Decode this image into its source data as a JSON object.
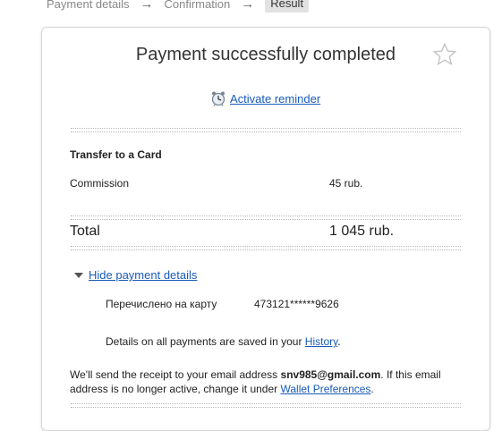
{
  "breadcrumbs": {
    "step1": "Payment details",
    "step2": "Confirmation",
    "step3": "Result",
    "separator": "→"
  },
  "card": {
    "title": "Payment successfully completed",
    "star_icon": "star-outline-icon",
    "reminder": {
      "icon": "alarm-clock-icon",
      "label": "Activate reminder"
    },
    "section_title": "Transfer to a Card",
    "commission_label": "Commission",
    "commission_value": "45 rub.",
    "total_label": "Total",
    "total_value": "1 045 rub.",
    "toggle_label": "Hide payment details",
    "transferred_label": "Перечислено на карту",
    "card_number": "473121******9626",
    "history_text_before": "Details on all payments are saved in your ",
    "history_link": "History",
    "history_text_after": ".",
    "receipt_part1": "We'll send the receipt to your email address ",
    "receipt_email": "snv985@gmail.com",
    "receipt_part2": ". If this email address is no longer active, change it under ",
    "receipt_link": "Wallet Preferences",
    "receipt_part3": "."
  },
  "colors": {
    "link": "#1a5bb9",
    "breadcrumb_active_bg": "#e2e2e2",
    "card_border": "#d6d6d6"
  }
}
